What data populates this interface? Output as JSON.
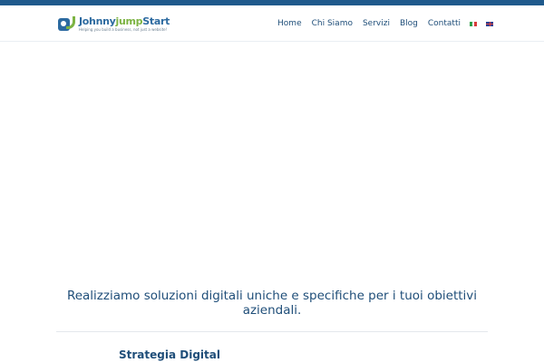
{
  "header": {
    "logo": {
      "name_part1": "Johnny",
      "name_part2": "jump",
      "name_part3": "Start",
      "tagline": "Helping you build a business, not just a website!"
    },
    "nav": [
      {
        "label": "Home"
      },
      {
        "label": "Chi Siamo"
      },
      {
        "label": "Servizi"
      },
      {
        "label": "Blog"
      },
      {
        "label": "Contatti"
      }
    ],
    "languages": [
      "it-flag-icon",
      "uk-flag-icon"
    ]
  },
  "main": {
    "tagline": "Realizziamo soluzioni digitali uniche e specifiche per i tuoi obiettivi aziendali.",
    "services": [
      {
        "title": "Strategia Digital"
      }
    ]
  },
  "colors": {
    "brand_blue": "#1f4e79",
    "top_strip": "#1f5a8c",
    "brand_green": "#7cb342"
  }
}
